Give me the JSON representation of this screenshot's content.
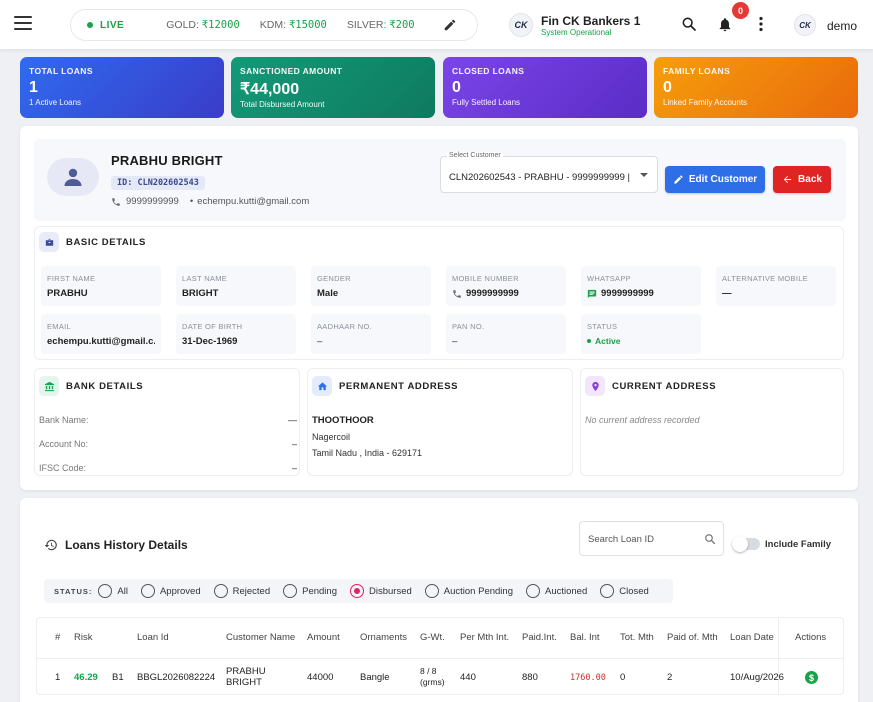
{
  "ticker": {
    "live": "LIVE",
    "gold_label": "GOLD:",
    "gold": "₹12000",
    "kdm_label": "KDM:",
    "kdm": "₹15000",
    "silver_label": "SILVER:",
    "silver": "₹200"
  },
  "brand": {
    "logo": "CK",
    "name": "Fin CK Bankers 1",
    "status": "System Operational"
  },
  "header": {
    "notifications": "0",
    "user_avatar": "CK",
    "user": "demo"
  },
  "stats": [
    {
      "label": "TOTAL LOANS",
      "value": "1",
      "sub": "1 Active Loans"
    },
    {
      "label": "SANCTIONED AMOUNT",
      "value": "₹44,000",
      "sub": "Total Disbursed Amount"
    },
    {
      "label": "CLOSED LOANS",
      "value": "0",
      "sub": "Fully Settled Loans"
    },
    {
      "label": "FAMILY LOANS",
      "value": "0",
      "sub": "Linked Family Accounts"
    }
  ],
  "profile": {
    "name": "PRABHU BRIGHT",
    "id": "ID: CLN202602543",
    "phone": "9999999999",
    "email": "echempu.kutti@gmail.com",
    "select_label": "Select Customer",
    "select_value": "CLN202602543 - PRABHU - 9999999999 |",
    "edit_label": "Edit Customer",
    "back_label": "Back"
  },
  "basic": {
    "title": "BASIC DETAILS",
    "fields": [
      {
        "k": "FIRST NAME",
        "v": "PRABHU"
      },
      {
        "k": "LAST NAME",
        "v": "BRIGHT"
      },
      {
        "k": "GENDER",
        "v": "Male"
      },
      {
        "k": "MOBILE NUMBER",
        "v": "9999999999"
      },
      {
        "k": "WHATSAPP",
        "v": "9999999999"
      },
      {
        "k": "ALTERNATIVE MOBILE",
        "v": "—"
      },
      {
        "k": "EMAIL",
        "v": "echempu.kutti@gmail.c..."
      },
      {
        "k": "DATE OF BIRTH",
        "v": "31-Dec-1969"
      },
      {
        "k": "AADHAAR NO.",
        "v": "–"
      },
      {
        "k": "PAN NO.",
        "v": "–"
      },
      {
        "k": "STATUS",
        "v": "Active"
      }
    ]
  },
  "bank": {
    "title": "BANK DETAILS",
    "rows": [
      {
        "k": "Bank Name:",
        "v": "—"
      },
      {
        "k": "Account No:",
        "v": "–"
      },
      {
        "k": "IFSC Code:",
        "v": "–"
      }
    ]
  },
  "permanent": {
    "title": "PERMANENT ADDRESS",
    "line1": "THOOTHOOR",
    "line2": "Nagercoil",
    "line3": "Tamil Nadu , India - 629171"
  },
  "current": {
    "title": "CURRENT ADDRESS",
    "empty": "No current address recorded"
  },
  "loans": {
    "title": "Loans History Details",
    "search_placeholder": "Search Loan ID",
    "include_family": "Include Family",
    "status_label": "STATUS:",
    "statuses": [
      "All",
      "Approved",
      "Rejected",
      "Pending",
      "Disbursed",
      "Auction Pending",
      "Auctioned",
      "Closed"
    ],
    "selected_status": "Disbursed",
    "columns": [
      "#",
      "Risk",
      "Loan Id",
      "Customer Name",
      "Amount",
      "Ornaments",
      "G-Wt.",
      "Per Mth Int.",
      "Paid.Int.",
      "Bal. Int",
      "Tot. Mth",
      "Paid of. Mth",
      "Loan Date",
      "Actions"
    ],
    "rows": [
      {
        "no": "1",
        "risk": "46.29",
        "grade": "B1",
        "loan_id": "BBGL2026082224",
        "customer1": "PRABHU",
        "customer2": "BRIGHT",
        "amount": "44000",
        "ornaments": "Bangle",
        "gwt1": "8 / 8",
        "gwt2": "(grms)",
        "per_mth": "440",
        "paid_int": "880",
        "bal_int": "1760.00",
        "tot_mth": "0",
        "paid_mth": "2",
        "loan_date": "10/Aug/2026"
      }
    ]
  },
  "colors": {
    "live": "#16a34a",
    "primary": "#2e6ee6",
    "danger": "#e02424",
    "selected_radio": "#e0245e",
    "bal_int": "#d32f2f"
  }
}
